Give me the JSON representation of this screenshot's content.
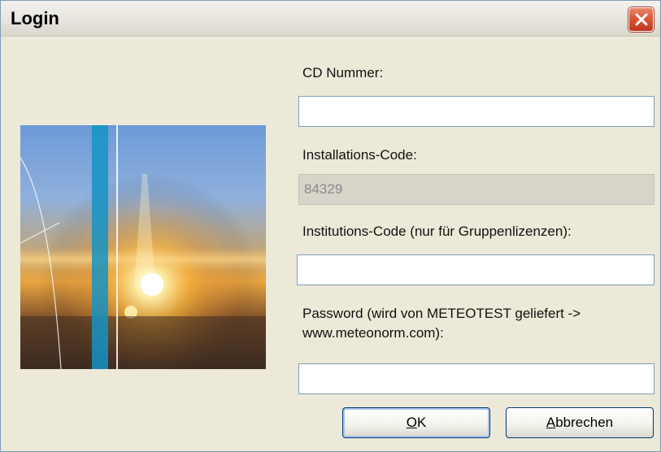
{
  "window": {
    "title": "Login"
  },
  "form": {
    "cd_number": {
      "label": "CD Nummer:",
      "value": ""
    },
    "installation_code": {
      "label": "Installations-Code:",
      "value": "84329"
    },
    "institution_code": {
      "label": "Institutions-Code (nur für Gruppenlizenzen):",
      "value": ""
    },
    "password": {
      "label": "Password (wird von METEOTEST geliefert ->\nwww.meteonorm.com):",
      "value": ""
    }
  },
  "buttons": {
    "ok": {
      "mnemonic": "O",
      "rest": "K"
    },
    "cancel": {
      "mnemonic": "A",
      "rest": "bbrechen"
    }
  },
  "colors": {
    "dialog_background": "#ece9d8",
    "close_button": "#d9573a",
    "disabled_field": "#d8d4ca"
  },
  "icons": {
    "close": "close-icon"
  }
}
